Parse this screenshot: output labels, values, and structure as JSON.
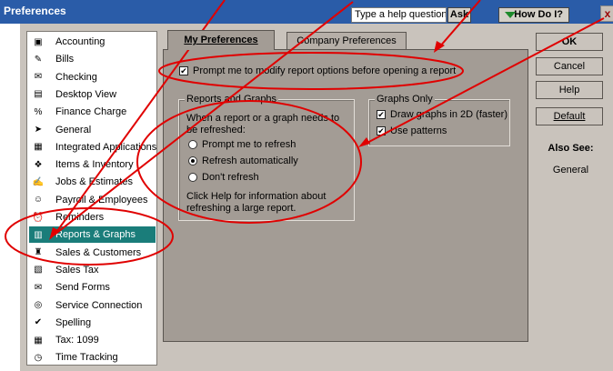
{
  "window": {
    "title": "Preferences"
  },
  "toolbar": {
    "help_placeholder": "Type a help question",
    "ask_label": "Ask",
    "howdo_label": "How Do I?",
    "close_label": "x"
  },
  "sidebar": {
    "items": [
      {
        "label": "Accounting",
        "icon": "accounting-icon",
        "glyph": "▣"
      },
      {
        "label": "Bills",
        "icon": "bills-icon",
        "glyph": "✎"
      },
      {
        "label": "Checking",
        "icon": "checking-icon",
        "glyph": "✉"
      },
      {
        "label": "Desktop View",
        "icon": "desktop-view-icon",
        "glyph": "▤"
      },
      {
        "label": "Finance Charge",
        "icon": "finance-charge-icon",
        "glyph": "%"
      },
      {
        "label": "General",
        "icon": "general-icon",
        "glyph": "➤"
      },
      {
        "label": "Integrated Applications",
        "icon": "integrated-applications-icon",
        "glyph": "▦"
      },
      {
        "label": "Items & Inventory",
        "icon": "items-inventory-icon",
        "glyph": "❖"
      },
      {
        "label": "Jobs & Estimates",
        "icon": "jobs-estimates-icon",
        "glyph": "✍"
      },
      {
        "label": "Payroll & Employees",
        "icon": "payroll-employees-icon",
        "glyph": "☺"
      },
      {
        "label": "Reminders",
        "icon": "reminders-icon",
        "glyph": "⏰"
      },
      {
        "label": "Reports & Graphs",
        "icon": "reports-graphs-icon",
        "glyph": "▥"
      },
      {
        "label": "Sales & Customers",
        "icon": "sales-customers-icon",
        "glyph": "♜"
      },
      {
        "label": "Sales Tax",
        "icon": "sales-tax-icon",
        "glyph": "▧"
      },
      {
        "label": "Send Forms",
        "icon": "send-forms-icon",
        "glyph": "✉"
      },
      {
        "label": "Service Connection",
        "icon": "service-connection-icon",
        "glyph": "◎"
      },
      {
        "label": "Spelling",
        "icon": "spelling-icon",
        "glyph": "✔"
      },
      {
        "label": "Tax: 1099",
        "icon": "tax-1099-icon",
        "glyph": "▦"
      },
      {
        "label": "Time Tracking",
        "icon": "time-tracking-icon",
        "glyph": "◷"
      }
    ],
    "selected": "Reports & Graphs"
  },
  "tabs": [
    {
      "label": "My Preferences",
      "active": true
    },
    {
      "label": "Company Preferences",
      "active": false
    }
  ],
  "prompt_option": {
    "label": "Prompt me to modify report options before opening a report",
    "checked": true
  },
  "reports_group": {
    "title": "Reports and Graphs",
    "description": "When a report or a graph needs to be refreshed:",
    "options": [
      {
        "label": "Prompt me to refresh",
        "selected": false
      },
      {
        "label": "Refresh automatically",
        "selected": true
      },
      {
        "label": "Don't refresh",
        "selected": false
      }
    ],
    "help_text": "Click Help for information about refreshing a large report."
  },
  "graphs_group": {
    "title": "Graphs Only",
    "options": [
      {
        "label": "Draw graphs in 2D (faster)",
        "checked": true
      },
      {
        "label": "Use patterns",
        "checked": true
      }
    ]
  },
  "buttons": {
    "ok": "OK",
    "cancel": "Cancel",
    "help": "Help",
    "default": "Default"
  },
  "also_see": {
    "title": "Also See:",
    "link": "General"
  },
  "colors": {
    "titlebar": "#2a5ca8",
    "panel": "#a39c95",
    "selected": "#1a7d7a",
    "annotation": "#e00000"
  }
}
